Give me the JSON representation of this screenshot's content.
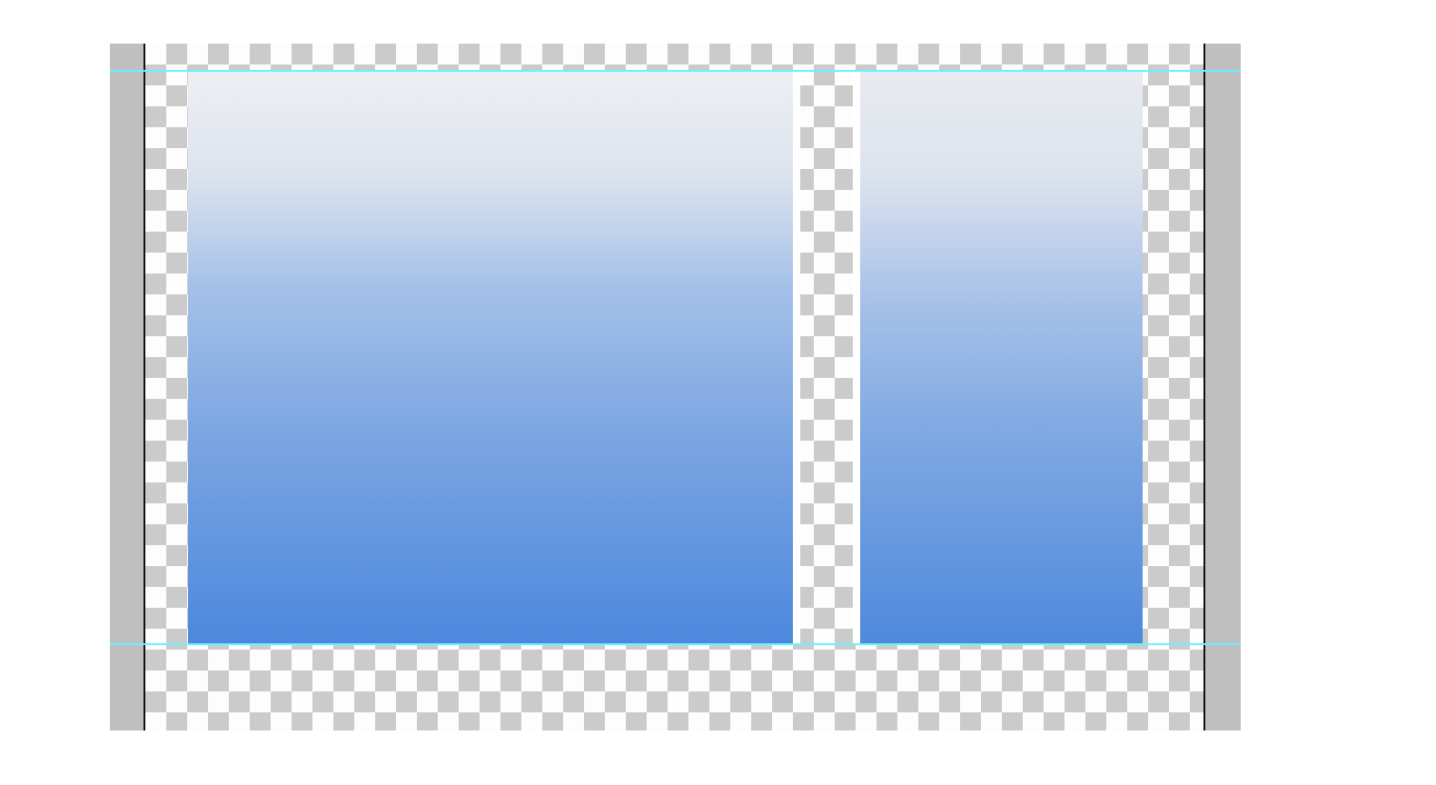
{
  "canvas": {
    "outer_band_color": "#bfbfbf",
    "transparency_checker_light": "#fdfdfd",
    "transparency_checker_dark": "#cbcbcb",
    "edge_line_color": "#111111",
    "guide_color": "#66f3ff"
  },
  "panels": [
    {
      "name": "left-gradient-panel",
      "gradient_top": "#edeff2",
      "gradient_mid": "#a4c0e8",
      "gradient_bottom": "#4d88dd"
    },
    {
      "name": "right-gradient-panel",
      "gradient_top": "#e8ebef",
      "gradient_mid": "#a7c1e8",
      "gradient_bottom": "#4f89dc"
    }
  ]
}
